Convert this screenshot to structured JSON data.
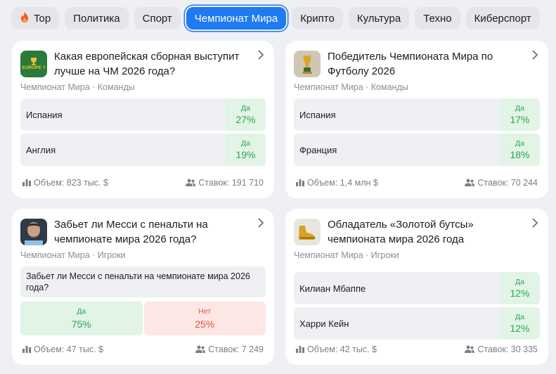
{
  "tabs": [
    {
      "label": "Top",
      "icon": "fire-icon",
      "active": false
    },
    {
      "label": "Политика",
      "active": false
    },
    {
      "label": "Спорт",
      "active": false
    },
    {
      "label": "Чемпионат Мира",
      "active": true
    },
    {
      "label": "Крипто",
      "active": false
    },
    {
      "label": "Культура",
      "active": false
    },
    {
      "label": "Техно",
      "active": false
    },
    {
      "label": "Киберспорт",
      "active": false
    }
  ],
  "cards": [
    {
      "title": "Какая европейская сборная выступит лучше на ЧМ 2026 года?",
      "meta": "Чемпионат Мира · Команды",
      "thumb_text": "EUROPE ?",
      "options": [
        {
          "name": "Испания",
          "label": "Да",
          "value": "27%"
        },
        {
          "name": "Англия",
          "label": "Да",
          "value": "19%"
        }
      ],
      "volume": "Объем: 823 тыс. $",
      "bets": "Ставок: 191 710"
    },
    {
      "title": "Победитель Чемпионата Мира по Футболу 2026",
      "meta": "Чемпионат Мира · Команды",
      "options": [
        {
          "name": "Испания",
          "label": "Да",
          "value": "17%"
        },
        {
          "name": "Франция",
          "label": "Да",
          "value": "18%"
        }
      ],
      "volume": "Объем: 1,4 млн $",
      "bets": "Ставок: 70 244"
    },
    {
      "title": "Забьет ли Месси с пенальти на чемпионате мира 2026 года?",
      "meta": "Чемпионат Мира · Игроки",
      "question": "Забьет ли Месси с пенальти на чемпионате мира 2026 года?",
      "yes": {
        "label": "Да",
        "value": "75%"
      },
      "no": {
        "label": "Нет",
        "value": "25%"
      },
      "volume": "Объем: 47 тыс. $",
      "bets": "Ставок: 7 249"
    },
    {
      "title": "Обладатель «Золотой бутсы» чемпионата мира 2026 года",
      "meta": "Чемпионат Мира · Игроки",
      "options": [
        {
          "name": "Килиан Мбаппе",
          "label": "Да",
          "value": "12%"
        },
        {
          "name": "Харри Кейн",
          "label": "Да",
          "value": "12%"
        }
      ],
      "volume": "Объем: 42 тыс. $",
      "bets": "Ставок: 30 335"
    }
  ],
  "colors": {
    "accent": "#1e7bf2",
    "yes": "#2aa556",
    "no": "#e5503f"
  }
}
